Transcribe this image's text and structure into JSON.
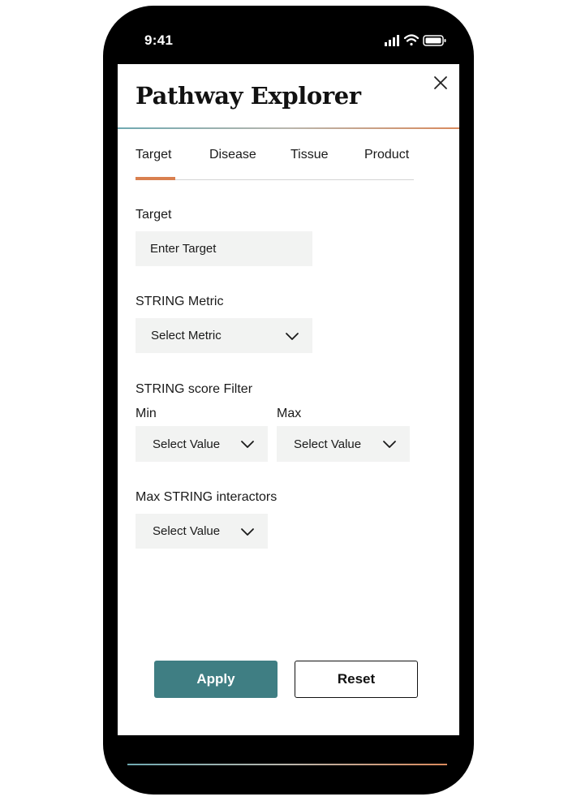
{
  "status_bar": {
    "time": "9:41"
  },
  "header": {
    "title": "Pathway Explorer"
  },
  "tabs": [
    {
      "label": "Target",
      "active": true
    },
    {
      "label": "Disease",
      "active": false
    },
    {
      "label": "Tissue",
      "active": false
    },
    {
      "label": "Product",
      "active": false
    }
  ],
  "form": {
    "target": {
      "label": "Target",
      "placeholder": "Enter Target"
    },
    "string_metric": {
      "label": "STRING Metric",
      "value": "Select Metric"
    },
    "score_filter": {
      "label": "STRING score Filter",
      "min": {
        "label": "Min",
        "value": "Select Value"
      },
      "max": {
        "label": "Max",
        "value": "Select Value"
      }
    },
    "max_interactors": {
      "label": "Max STRING interactors",
      "value": "Select Value"
    }
  },
  "actions": {
    "apply_label": "Apply",
    "reset_label": "Reset"
  },
  "colors": {
    "accent_orange": "#d9804f",
    "primary_teal": "#3f7e83",
    "field_background": "#f2f3f2"
  }
}
